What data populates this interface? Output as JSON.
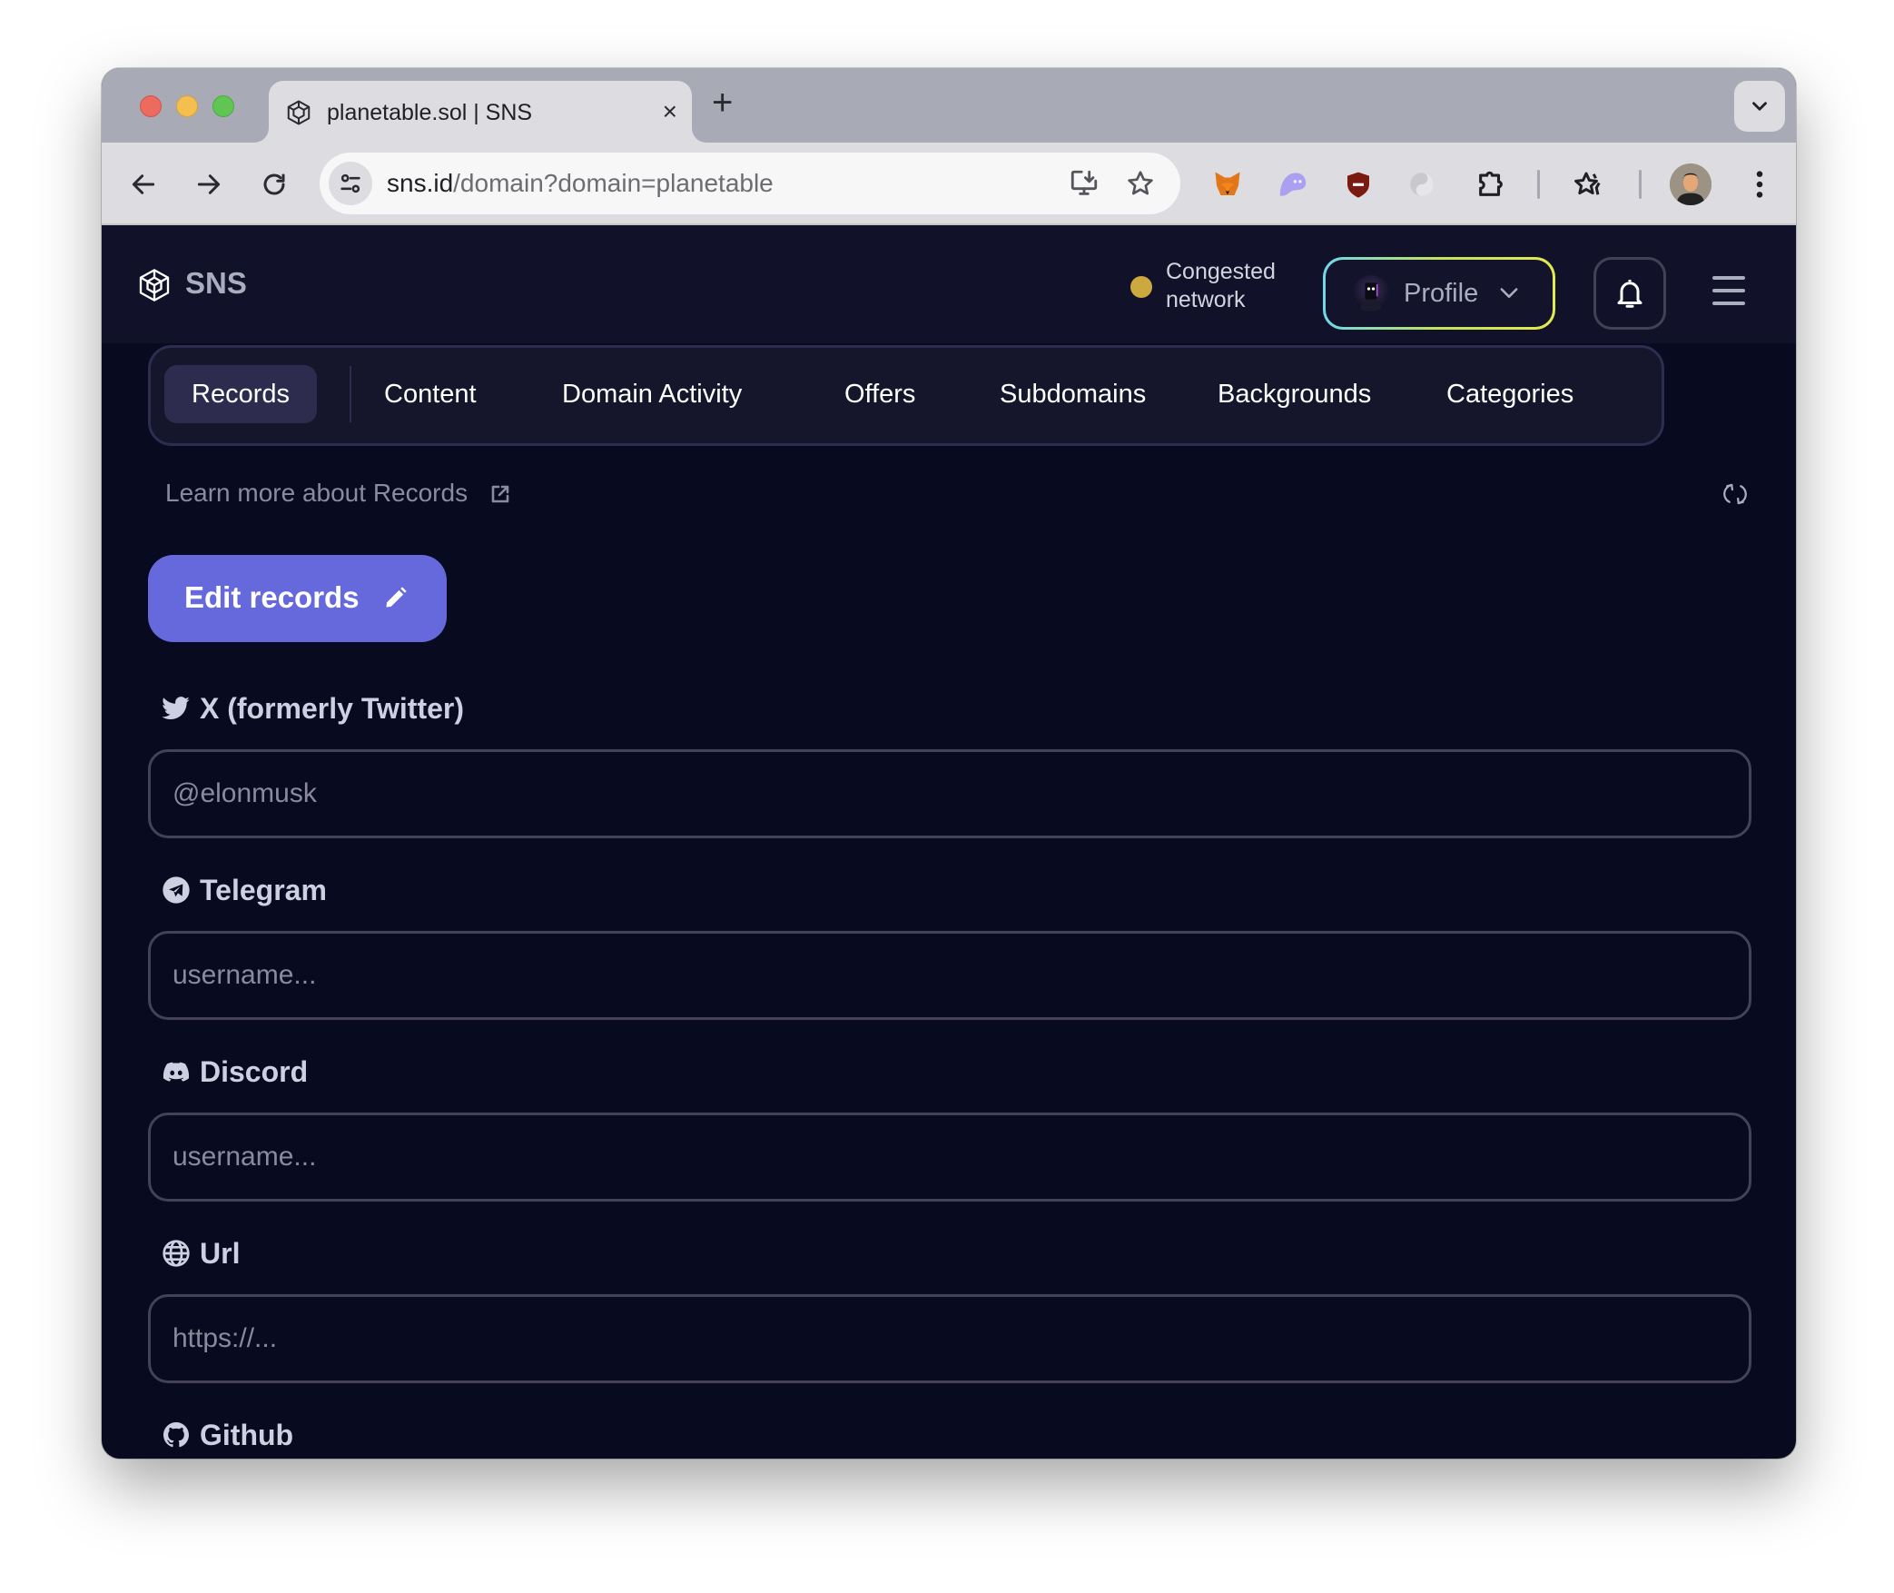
{
  "browser": {
    "tab": {
      "title": "planetable.sol | SNS",
      "close_label": "×"
    },
    "new_tab_label": "+",
    "url_host": "sns.id",
    "url_path": "/domain?domain=planetable",
    "extensions": [
      "metamask-icon",
      "phantom-icon",
      "shield-blocker-icon",
      "gray-swirl-icon",
      "puzzle-extensions-icon"
    ]
  },
  "header": {
    "logo_text": "SNS",
    "network_status": {
      "line1": "Congested",
      "line2": "network",
      "color": "#cba93e"
    },
    "profile_label": "Profile"
  },
  "nav": {
    "tabs": [
      {
        "label": "Records",
        "active": true
      },
      {
        "label": "Content"
      },
      {
        "label": "Domain Activity"
      },
      {
        "label": "Offers"
      },
      {
        "label": "Subdomains"
      },
      {
        "label": "Backgrounds"
      },
      {
        "label": "Categories"
      }
    ]
  },
  "records": {
    "learn_more": "Learn more about Records",
    "edit_button": "Edit records",
    "accent_color": "#6669dc",
    "fields": [
      {
        "label": "X (formerly Twitter)",
        "icon": "twitter-icon",
        "placeholder": "@elonmusk",
        "value": ""
      },
      {
        "label": "Telegram",
        "icon": "telegram-icon",
        "placeholder": "username...",
        "value": ""
      },
      {
        "label": "Discord",
        "icon": "discord-icon",
        "placeholder": "username...",
        "value": ""
      },
      {
        "label": "Url",
        "icon": "globe-icon",
        "placeholder": "https://...",
        "value": ""
      },
      {
        "label": "Github",
        "icon": "github-icon"
      }
    ]
  }
}
